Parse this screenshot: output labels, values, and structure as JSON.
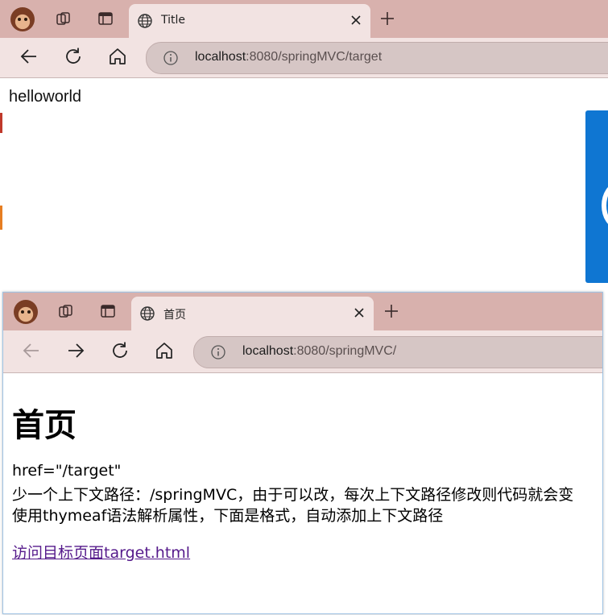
{
  "window1": {
    "tab_title": "Title",
    "url_host": "localhost",
    "url_rest": ":8080/springMVC/target",
    "body_text": "helloworld"
  },
  "window2": {
    "tab_title": "首页",
    "url_host": "localhost",
    "url_rest": ":8080/springMVC/",
    "heading": "首页",
    "line1": "href=\"/target\"",
    "line2": "少一个上下文路径：/springMVC，由于可以改，每次上下文路径修改则代码就会变",
    "line3": "使用thymeaf语法解析属性，下面是格式，自动添加上下文路径",
    "link_text": "访问目标页面target.html"
  },
  "colors": {
    "tabstrip": "#d8b1ad",
    "toolbar": "#f2e3e2",
    "link": "#551a8b",
    "accent_panel": "#0f76d2"
  },
  "icons": [
    "avatar",
    "collections-icon",
    "tab-actions-icon",
    "globe-icon",
    "close-icon",
    "new-tab-icon",
    "back-icon",
    "forward-icon",
    "refresh-icon",
    "home-icon",
    "info-icon"
  ]
}
